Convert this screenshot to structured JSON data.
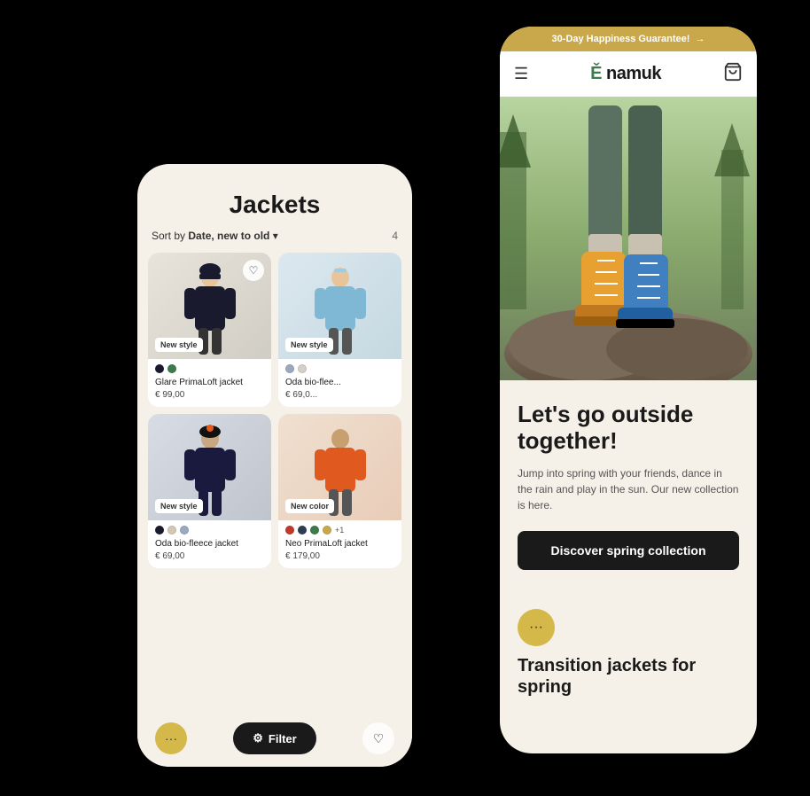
{
  "back_phone": {
    "title": "Jackets",
    "sort_label": "Sort by",
    "sort_value": "Date, new to old",
    "sort_count": "4",
    "products": [
      {
        "name": "Glare PrimaLoft jacket",
        "price": "€ 99,00",
        "badge": "New style",
        "colors": [
          "#1a1a2e",
          "#3d7a4e"
        ],
        "bg": "#e8e4dc",
        "show_wishlist": true
      },
      {
        "name": "Oda bio-flee...",
        "price": "€ 69,0...",
        "badge": "New style",
        "colors": [
          "#9ba8c0",
          "#d4d0c8"
        ],
        "bg": "#dce8f4",
        "show_wishlist": false
      },
      {
        "name": "Oda bio-fleece jacket",
        "price": "€ 69,00",
        "badge": "New style",
        "colors": [
          "#1a1a2e",
          "#d4c8b4",
          "#9ba8c0"
        ],
        "bg": "#d8dce8",
        "show_wishlist": false
      },
      {
        "name": "Neo PrimaLoft jacket",
        "price": "€ 179,00",
        "badge": "New color",
        "colors": [
          "#c0392b",
          "#2c3e50",
          "#3d7a4e",
          "#c9a84c"
        ],
        "bg": "#f0ddd0",
        "show_wishlist": false,
        "extra": "+1"
      }
    ],
    "filter_label": "Filter",
    "chat_icon": "···"
  },
  "front_phone": {
    "announce": {
      "text": "30-Day Happiness Guarantee!",
      "arrow": "→"
    },
    "nav": {
      "menu_icon": "☰",
      "logo": "Ě namuk",
      "cart_icon": "🛍"
    },
    "hero": {
      "alt": "Child hiking boots on rocks"
    },
    "content": {
      "headline": "Let's go outside together!",
      "subtext": "Jump into spring with your friends, dance in the rain and play in the sun. Our new collection is here.",
      "cta_label": "Discover spring collection"
    },
    "next_section": {
      "chat_icon": "···",
      "title": "Transition jackets for spring"
    }
  }
}
